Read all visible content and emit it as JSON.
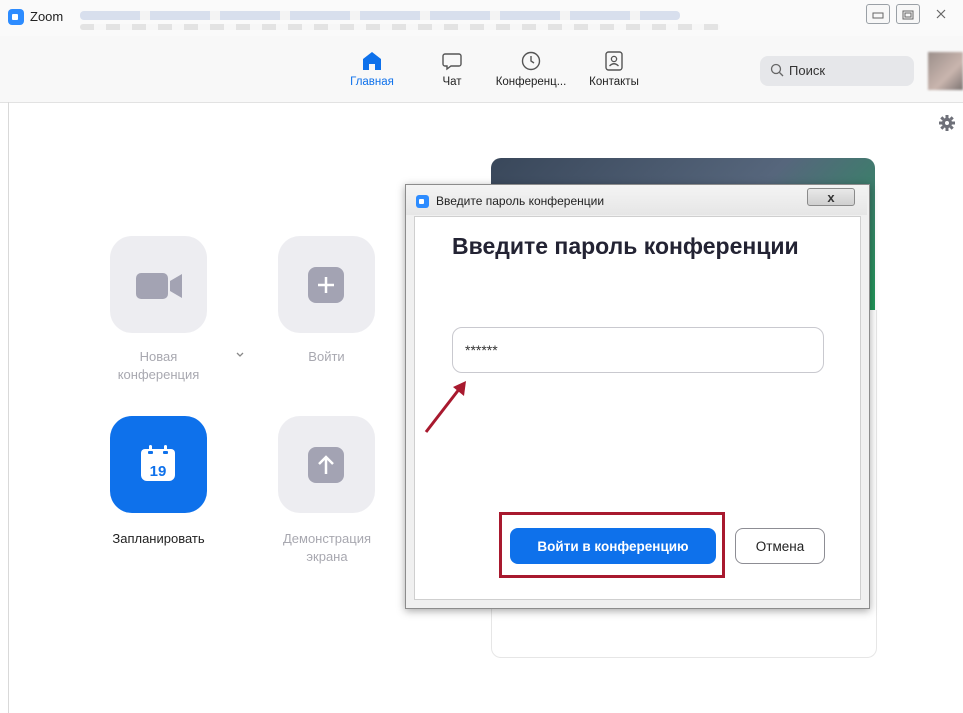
{
  "window": {
    "app_title": "Zoom"
  },
  "toolbar": {
    "tabs": [
      {
        "label": "Главная",
        "icon": "home-icon",
        "active": true
      },
      {
        "label": "Чат",
        "icon": "chat-icon",
        "active": false
      },
      {
        "label": "Конференц...",
        "icon": "clock-icon",
        "active": false
      },
      {
        "label": "Контакты",
        "icon": "contacts-icon",
        "active": false
      }
    ],
    "search_label": "Поиск"
  },
  "home": {
    "new_meeting_label_1": "Новая",
    "new_meeting_label_2": "конференция",
    "join_label": "Войти",
    "schedule_label": "Запланировать",
    "schedule_day": "19",
    "share_label_1": "Демонстрация",
    "share_label_2": "экрана"
  },
  "dialog": {
    "window_title": "Введите пароль конференции",
    "close_label": "x",
    "heading": "Введите пароль конференции",
    "password_value": "******",
    "join_button": "Войти в конференцию",
    "cancel_button": "Отмена"
  },
  "colors": {
    "accent": "#0e71eb",
    "highlight": "#a8192e",
    "tile_bg": "#ededf1"
  }
}
